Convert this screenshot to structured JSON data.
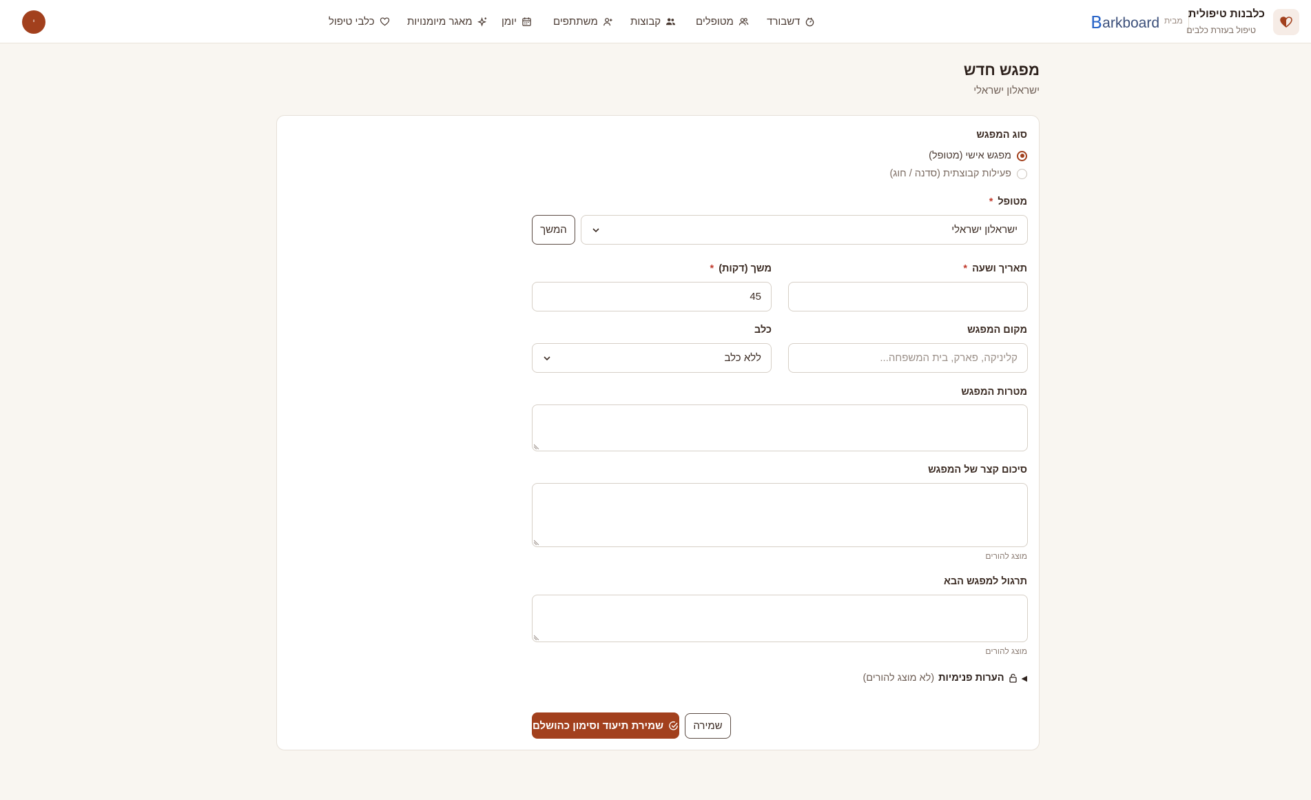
{
  "header": {
    "brand_title": "כלבנות טיפולית",
    "brand_subtitle": "טיפול בעזרת כלבים",
    "by_label": "מבית",
    "barkboard_mark": "B",
    "barkboard_rest": "arkboard",
    "avatar_initial": "י",
    "nav": [
      {
        "label": "דשבורד",
        "icon": "dashboard-icon"
      },
      {
        "label": "מטופלים",
        "icon": "users-icon"
      },
      {
        "label": "קבוצות",
        "icon": "groups-icon"
      },
      {
        "label": "משתתפים",
        "icon": "user-plus-icon"
      },
      {
        "label": "יומן",
        "icon": "calendar-icon"
      },
      {
        "label": "מאגר מיומנויות",
        "icon": "sparkles-icon"
      },
      {
        "label": "כלבי טיפול",
        "icon": "heart-icon"
      }
    ]
  },
  "page": {
    "title": "מפגש חדש",
    "subtitle": "ישראלון ישראלי"
  },
  "form": {
    "meeting_type": {
      "label": "סוג המפגש",
      "options": [
        {
          "label": "מפגש אישי (מטופל)",
          "checked": true
        },
        {
          "label": "פעילות קבוצתית (סדנה / חוג)",
          "checked": false
        }
      ]
    },
    "patient": {
      "label": "מטופל",
      "required_mark": "*",
      "value": "ישראלון ישראלי",
      "continue_label": "המשך"
    },
    "datetime": {
      "label": "תאריך ושעה",
      "required_mark": "*",
      "value": ""
    },
    "duration": {
      "label": "משך (דקות)",
      "required_mark": "*",
      "value": "45"
    },
    "location": {
      "label": "מקום המפגש",
      "placeholder": "קליניקה, פארק, בית המשפחה..."
    },
    "dog": {
      "label": "כלב",
      "value": "ללא כלב"
    },
    "goals": {
      "label": "מטרות המפגש"
    },
    "summary": {
      "label": "סיכום קצר של המפגש",
      "hint": "מוצג להורים"
    },
    "exercise": {
      "label": "תרגול למפגש הבא",
      "hint": "מוצג להורים"
    },
    "internal_notes": {
      "arrow": "◀",
      "label": "הערות פנימיות",
      "note": "(לא מוצג להורים)"
    },
    "actions": {
      "save_complete_label": "שמירת תיעוד וסימון כהושלם",
      "save_label": "שמירה"
    }
  },
  "colors": {
    "accent": "#a2401d",
    "background": "#f9f6f1",
    "card": "#ffffff",
    "brand_blue": "#2b66c8"
  }
}
